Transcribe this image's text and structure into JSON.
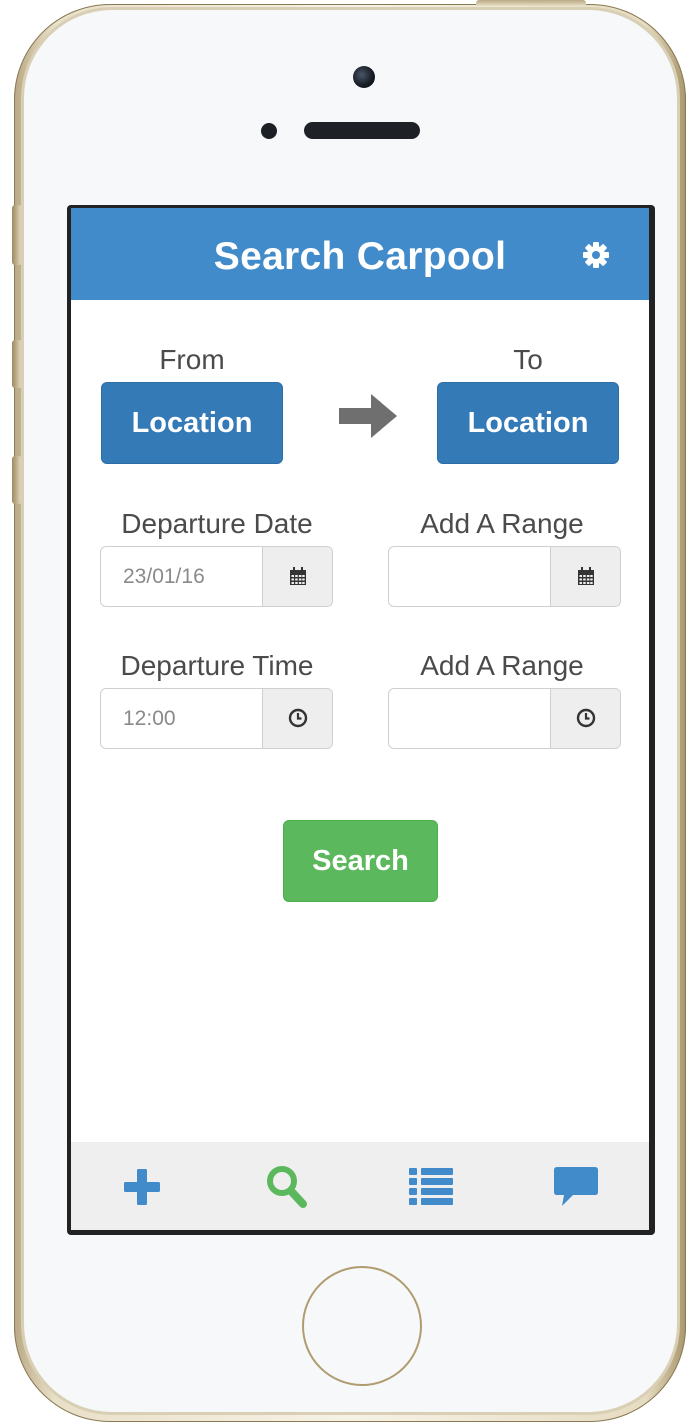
{
  "header": {
    "title": "Search Carpool",
    "settings_icon": "gear-icon"
  },
  "route": {
    "from_label": "From",
    "from_button": "Location",
    "to_label": "To",
    "to_button": "Location",
    "arrow_icon": "arrow-right-icon"
  },
  "departure_date": {
    "label": "Departure Date",
    "value": "23/01/16",
    "icon": "calendar-icon"
  },
  "date_range": {
    "label": "Add A Range",
    "value": "",
    "icon": "calendar-icon"
  },
  "departure_time": {
    "label": "Departure Time",
    "value": "12:00",
    "icon": "clock-icon"
  },
  "time_range": {
    "label": "Add A Range",
    "value": "",
    "icon": "clock-icon"
  },
  "search_button": "Search",
  "tabs": [
    {
      "icon": "plus-icon",
      "color": "#428bca"
    },
    {
      "icon": "search-icon",
      "color": "#5cb85c"
    },
    {
      "icon": "list-icon",
      "color": "#428bca"
    },
    {
      "icon": "chat-bubble-icon",
      "color": "#428bca"
    }
  ],
  "colors": {
    "header": "#428bca",
    "primary_button": "#337ab7",
    "success_button": "#5cb85c",
    "tab_bar": "#efefef"
  }
}
